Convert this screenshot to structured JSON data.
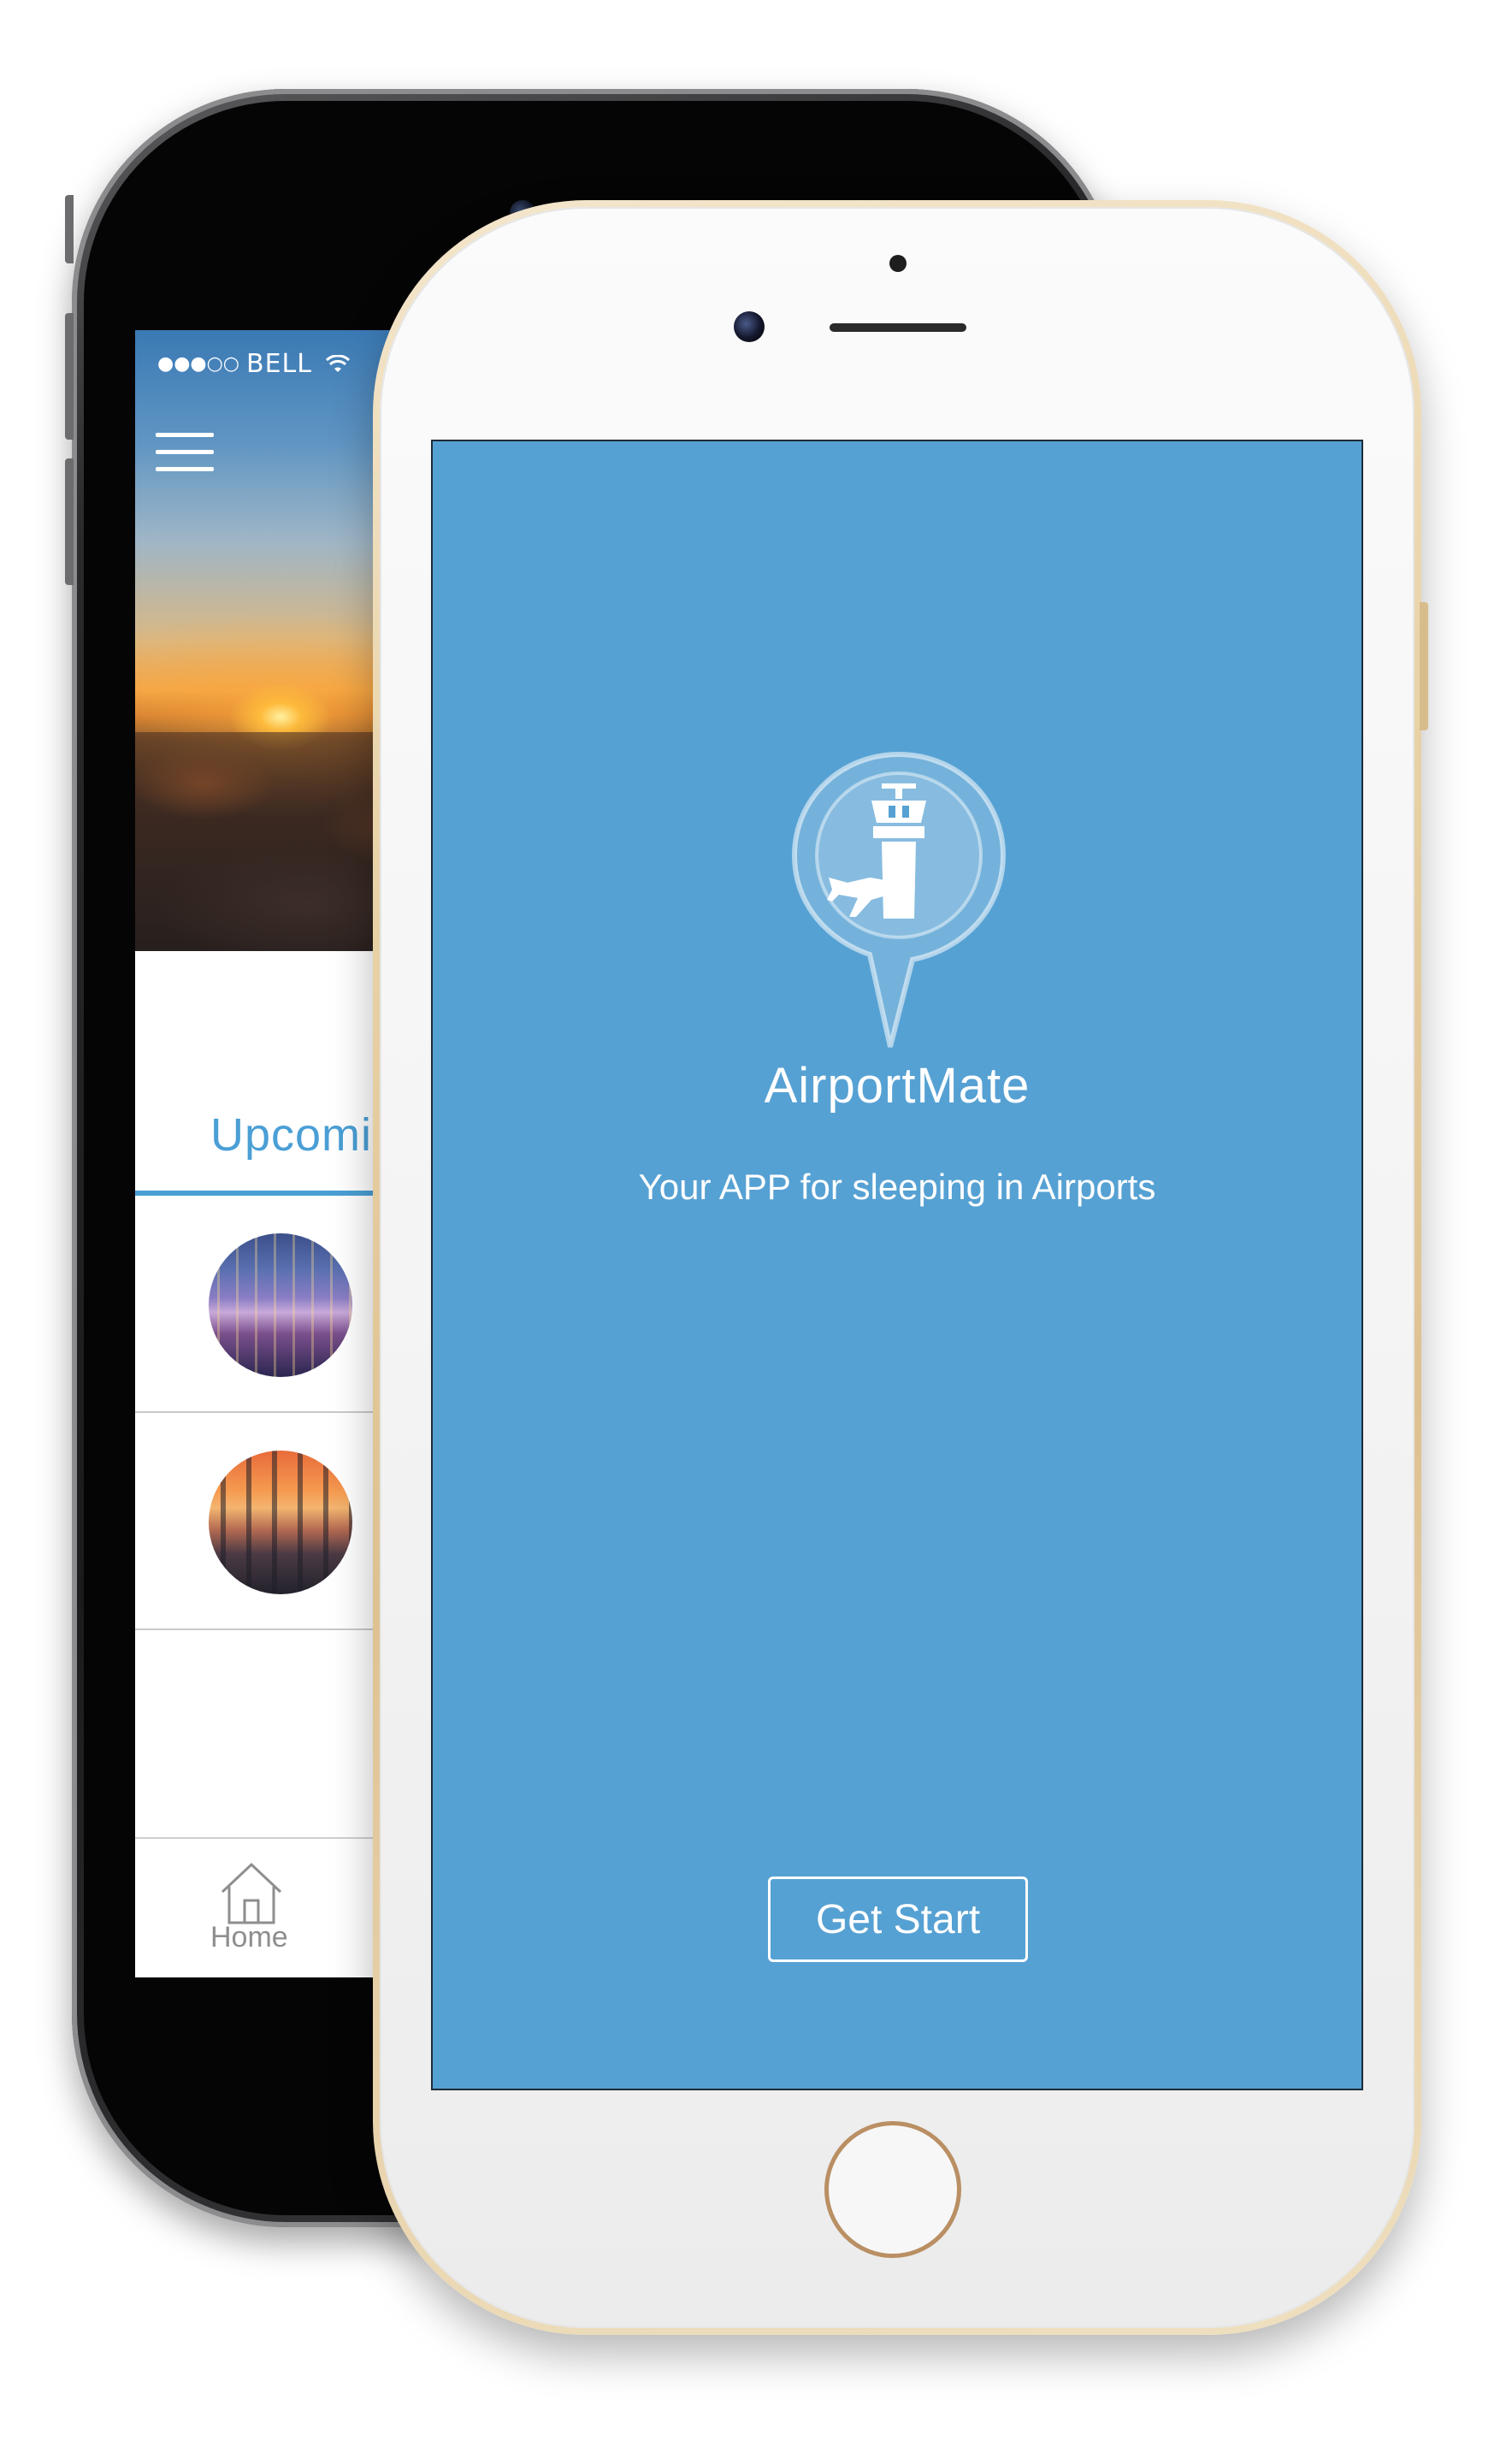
{
  "back_phone": {
    "status_bar": {
      "signal": "●●●○○",
      "carrier": "BELL"
    },
    "icons": {
      "menu": "hamburger-menu-icon",
      "wifi": "wifi-icon",
      "home": "home-icon"
    },
    "section_title": "Upcomin",
    "trips": [
      {
        "image": "city-skyline-night"
      },
      {
        "image": "city-skyline-sunset"
      }
    ],
    "tabbar": {
      "home_label": "Home"
    }
  },
  "front_phone": {
    "app": {
      "name": "AirportMate",
      "tagline": "Your APP for sleeping in Airports",
      "start_button_label": "Get Start",
      "logo_icon": "airport-tower-plane-pin-icon"
    }
  },
  "colors": {
    "screen_blue": "#56a1d3",
    "accent_blue": "#4a9fd5",
    "text_white": "#ffffff",
    "tab_gray": "#8e8e8e",
    "gold_frame": "#dec191",
    "dark_frame": "#1b1b1d"
  }
}
